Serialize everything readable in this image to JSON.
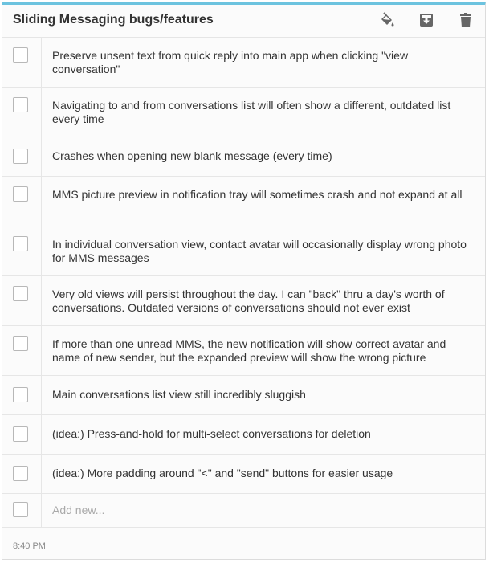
{
  "note": {
    "title": "Sliding Messaging bugs/features",
    "accent_color": "#6cc3df",
    "icons": [
      "paint-bucket-icon",
      "archive-icon",
      "trash-icon"
    ],
    "items": [
      "Preserve unsent text from quick reply into main app when clicking \"view conversation\"",
      "Navigating to and from conversations list will often show a different, outdated list every time",
      "Crashes when opening new blank message (every time)",
      "MMS picture preview in notification tray will sometimes crash and not expand at all",
      "In individual conversation view, contact avatar will occasionally display wrong photo for MMS messages",
      "Very old views will persist throughout the day. I can \"back\" thru a day's worth of conversations. Outdated versions of conversations should not ever exist",
      "If more than one unread MMS, the new notification will show correct avatar and name of new sender, but the expanded preview will show the wrong picture",
      "Main conversations list view still incredibly sluggish",
      "(idea:) Press-and-hold for multi-select conversations for deletion",
      "(idea:) More padding around \"<\" and \"send\" buttons for easier usage"
    ],
    "add_placeholder": "Add new...",
    "timestamp": "8:40 PM"
  }
}
